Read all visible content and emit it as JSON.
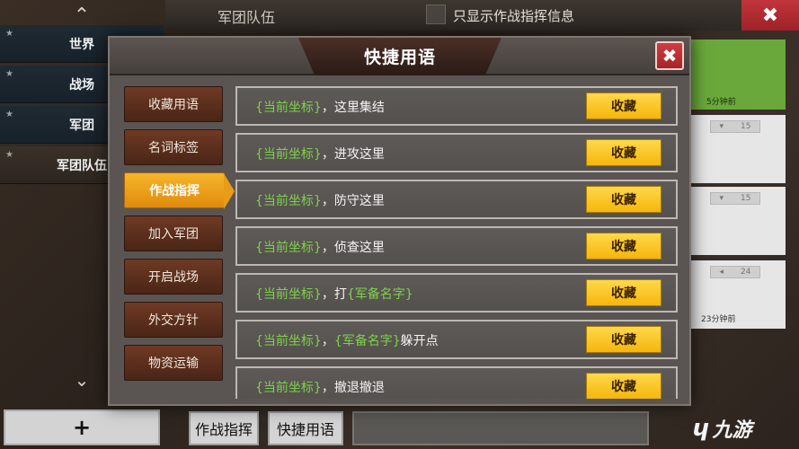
{
  "sidebar": {
    "up_glyph": "⌃",
    "down_glyph": "⌄",
    "channels": [
      {
        "label": "世界"
      },
      {
        "label": "战场"
      },
      {
        "label": "军团"
      },
      {
        "label": "军团队伍"
      }
    ]
  },
  "topbar": {
    "title": "军团队伍",
    "checkbox_label": "只显示作战指挥信息",
    "close_glyph": "✖"
  },
  "messages": [
    {
      "time": "5分钟前"
    },
    {
      "pill": "15"
    },
    {
      "pill": "15"
    },
    {
      "pill": "24",
      "time": "23分钟前"
    }
  ],
  "bottom": {
    "plus_label": "+",
    "command_label": "作战指挥",
    "quick_label": "快捷用语"
  },
  "watermark": {
    "text": "九游",
    "mark": "ɥ"
  },
  "modal": {
    "title": "快捷用语",
    "close_glyph": "✖",
    "categories": [
      {
        "label": "收藏用语"
      },
      {
        "label": "名词标签"
      },
      {
        "label": "作战指挥",
        "active": true
      },
      {
        "label": "加入军团"
      },
      {
        "label": "开启战场"
      },
      {
        "label": "外交方针"
      },
      {
        "label": "物资运输"
      }
    ],
    "favorite_label": "收藏",
    "tags": {
      "coord": "{当前坐标}",
      "unit": "{军备名字}"
    },
    "phrases": [
      {
        "sep": "，",
        "text": "这里集结"
      },
      {
        "sep": "，",
        "text": "进攻这里"
      },
      {
        "sep": "，",
        "text": "防守这里"
      },
      {
        "sep": "，",
        "text": "侦查这里"
      },
      {
        "sep": "，",
        "text": "打"
      },
      {
        "sep": "，",
        "text": "躲开点"
      },
      {
        "sep": "，",
        "text": "撤退撤退"
      }
    ]
  },
  "colors": {
    "accent_orange": "#f0a01c",
    "favorite_yellow": "#f5b60c",
    "tag_green": "#7dd24a",
    "close_red": "#c0353b"
  }
}
